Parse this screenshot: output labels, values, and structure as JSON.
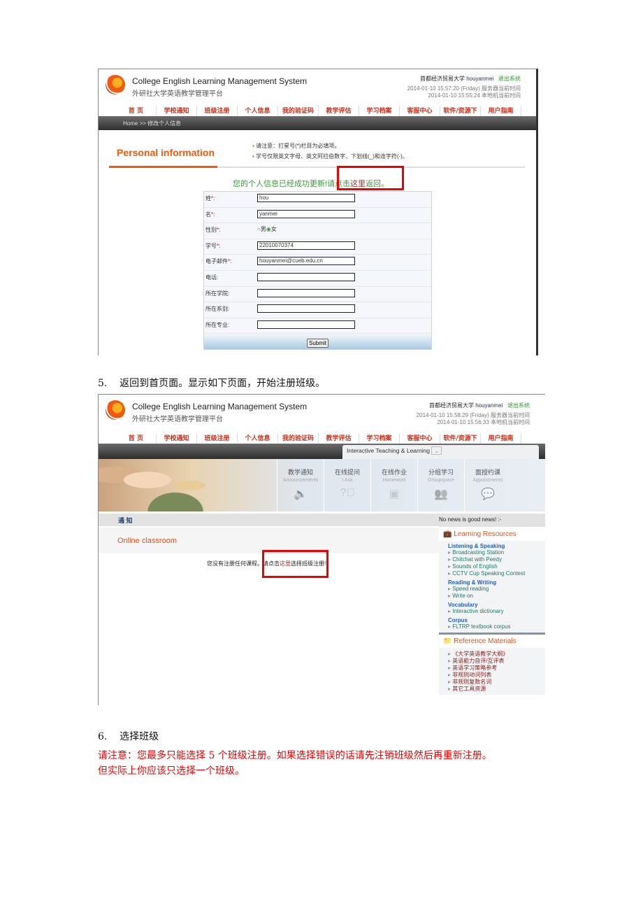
{
  "site": {
    "title": "College English Learning Management System",
    "subtitle": "外研社大学英语教学管理平台",
    "university": "首都经济贸易大学",
    "user": "houyanmei",
    "logout": "退出系统"
  },
  "nav": [
    "首 页",
    "学校通知",
    "班级注册",
    "个人信息",
    "我的验证码",
    "教学评估",
    "学习档案",
    "客服中心",
    "软件/资源下载",
    "用户指南"
  ],
  "shot1": {
    "server_time": "2014-01-10 15:57:20 (Friday) 服务器当前时间",
    "local_time": "2014-01-10 15:55:24 本地机当前时间",
    "breadcrumb": "Home >> 修改个人信息",
    "heading": "Personal information",
    "note1": "请注意：打星号(*)栏目为必填项。",
    "note2": "学号仅限英文字母、英文阿拉伯数字、下划线(_)和连字符(-)。",
    "success": "您的个人信息已经成功更新!",
    "return_pre": "请点击",
    "return_link": "这里",
    "return_post": "返回。",
    "fields": [
      {
        "label": "姓",
        "required": true,
        "value": "hou"
      },
      {
        "label": "名",
        "required": true,
        "value": "yanmei"
      },
      {
        "label": "性别",
        "required": true,
        "type": "radio",
        "options": [
          "男",
          "女"
        ],
        "selected": "女"
      },
      {
        "label": "学号",
        "required": true,
        "value": "22010070374"
      },
      {
        "label": "电子邮件",
        "required": true,
        "value": "houyanmei@cueb.edu.cn"
      },
      {
        "label": "电话",
        "value": ""
      },
      {
        "label": "所在学院",
        "value": ""
      },
      {
        "label": "所在系别",
        "value": ""
      },
      {
        "label": "所在专业",
        "value": ""
      }
    ],
    "submit": "Submit"
  },
  "step5": {
    "num": "5.",
    "text": "返回到首页面。显示如下页面，开始注册班级。"
  },
  "shot2": {
    "server_time": "2014-01-10 15:58:29 (Friday) 服务器当前时间",
    "local_time": "2014-01-10 15:56:33 本地机当前时间",
    "dropdown": "Interactive Teaching & Learning",
    "tiles": [
      {
        "zh": "教学通知",
        "en": "Announcements",
        "icon": "speaker-icon"
      },
      {
        "zh": "在线提问",
        "en": "I Ask",
        "icon": "question-icon"
      },
      {
        "zh": "在线作业",
        "en": "Homework",
        "icon": "computer-icon"
      },
      {
        "zh": "分组学习",
        "en": "Groupspace",
        "icon": "group-icon"
      },
      {
        "zh": "面授约课",
        "en": "Appointments",
        "icon": "chat-icon"
      }
    ],
    "notice": "通 知",
    "news": "No news is good news! :-",
    "heading": "Online classroom",
    "msg_pre": "您没有注册任何课程。",
    "msg_click": "请点击",
    "msg_link": "这里",
    "msg_post": "选择班级注册!",
    "learning_resources": {
      "title": "Learning Resources",
      "groups": [
        {
          "name": "Listening & Speaking",
          "items": [
            "Broadcasting Station",
            "Chitchat with Peedy",
            "Sounds of English",
            "CCTV Cup Speaking Contest"
          ]
        },
        {
          "name": "Reading & Writing",
          "items": [
            "Speed reading",
            "Write on"
          ]
        },
        {
          "name": "Vocabulary",
          "items": [
            "Interactive dictionary"
          ]
        },
        {
          "name": "Corpus",
          "items": [
            "FLTRP textbook corpus"
          ]
        }
      ]
    },
    "reference": {
      "title": "Reference Materials",
      "items": [
        "《大学英语教学大纲》",
        "英语能力自评/互评表",
        "英语学习策略参考",
        "非规则动词列表",
        "非规则复数名词",
        "其它工具资源"
      ]
    }
  },
  "step6": {
    "num": "6.",
    "text": "选择班级",
    "warn1": "请注意：您最多只能选择 5 个班级注册。如果选择错误的话请先注销班级然后再重新注册。",
    "warn2": "但实际上你应该只选择一个班级。"
  }
}
